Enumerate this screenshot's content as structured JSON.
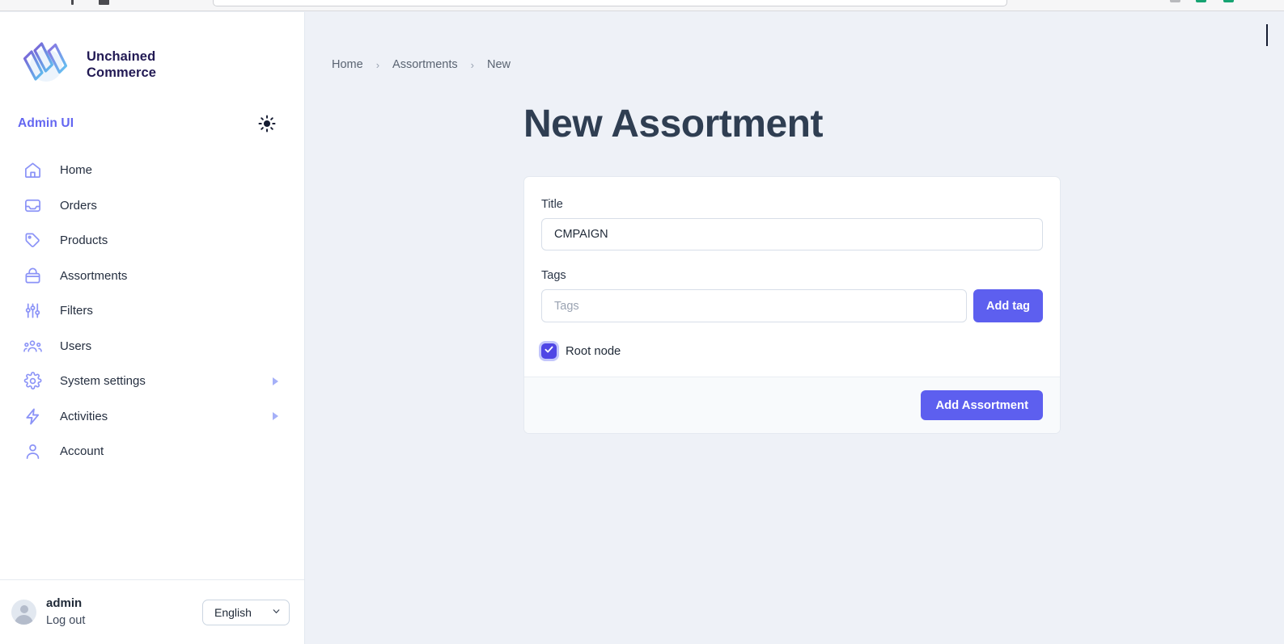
{
  "browser": {
    "chrome_visible": true
  },
  "sidebar": {
    "brand": {
      "logo_icon": "unchained-logo-icon",
      "name_line1": "Unchained",
      "name_line2": "Commerce"
    },
    "admin_title": "Admin UI",
    "theme_toggle_icon": "sun-icon",
    "items": [
      {
        "label": "Home",
        "icon": "home-icon",
        "has_submenu": false
      },
      {
        "label": "Orders",
        "icon": "inbox-icon",
        "has_submenu": false
      },
      {
        "label": "Products",
        "icon": "tag-icon",
        "has_submenu": false
      },
      {
        "label": "Assortments",
        "icon": "archive-icon",
        "has_submenu": false
      },
      {
        "label": "Filters",
        "icon": "sliders-icon",
        "has_submenu": false
      },
      {
        "label": "Users",
        "icon": "users-icon",
        "has_submenu": false
      },
      {
        "label": "System settings",
        "icon": "gear-icon",
        "has_submenu": true
      },
      {
        "label": "Activities",
        "icon": "bolt-icon",
        "has_submenu": true
      },
      {
        "label": "Account",
        "icon": "person-icon",
        "has_submenu": false
      }
    ],
    "footer": {
      "avatar_icon": "avatar-icon",
      "user_name": "admin",
      "logout_label": "Log out",
      "language_value": "English",
      "language_caret_icon": "chevron-down-icon"
    }
  },
  "main": {
    "breadcrumb": {
      "separator": "›",
      "items": [
        "Home",
        "Assortments",
        "New"
      ]
    },
    "page_title": "New Assortment",
    "form": {
      "title_field": {
        "label": "Title",
        "value": "CMPAIGN",
        "placeholder": ""
      },
      "tags_field": {
        "label": "Tags",
        "value": "",
        "placeholder": "Tags",
        "add_button_label": "Add tag"
      },
      "root_node": {
        "label": "Root node",
        "checked": true,
        "check_icon": "check-icon"
      },
      "submit_label": "Add Assortment"
    }
  },
  "colors": {
    "accent": "#5d5fef",
    "accent_dark": "#4f46e5",
    "sidebar_icon": "#8b93f7",
    "page_bg": "#eef1f7",
    "card_bg": "#ffffff",
    "title_text": "#2f3e52",
    "brand_text": "#221a54"
  }
}
